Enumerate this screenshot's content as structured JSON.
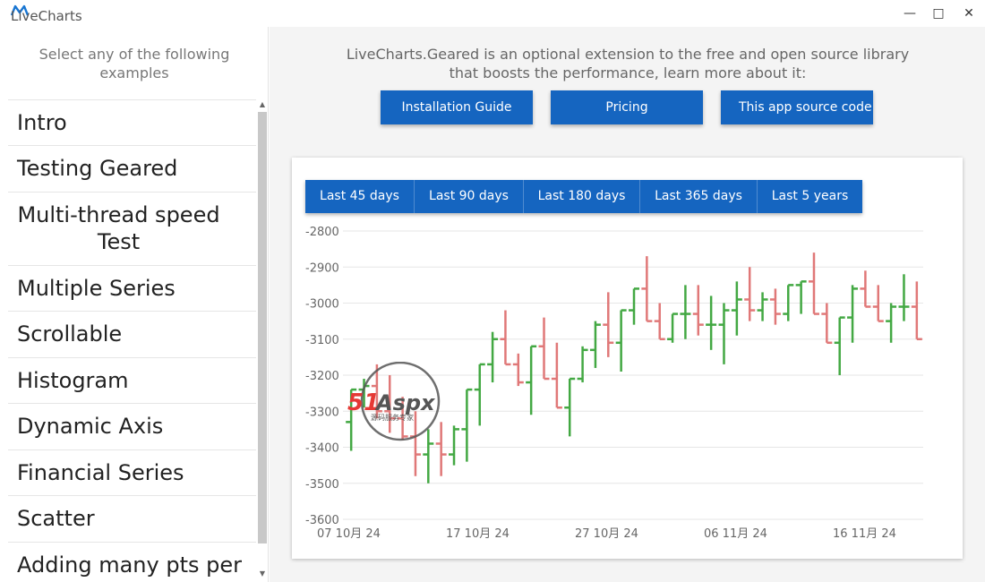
{
  "window": {
    "title": "LiveCharts",
    "minimize_glyph": "—",
    "maximize_glyph": "□",
    "close_glyph": "✕"
  },
  "sidebar": {
    "header": "Select any of the following examples",
    "items": [
      "Intro",
      "Testing Geared",
      "Multi-thread speed Test",
      "Multiple Series",
      "Scrollable",
      "Histogram",
      "Dynamic Axis",
      "Financial Series",
      "Scatter",
      "Adding many pts per"
    ]
  },
  "main": {
    "intro_text": "LiveCharts.Geared is an optional extension to the free and open source library that boosts the performance, learn more about it:",
    "buttons": [
      "Installation Guide",
      "Pricing",
      "This app source code"
    ]
  },
  "chart_controls": {
    "ranges": [
      "Last 45 days",
      "Last 90 days",
      "Last 180 days",
      "Last 365 days",
      "Last 5 years"
    ]
  },
  "watermark": {
    "brand": "51Aspx",
    "subtitle": "源码服务专家"
  },
  "colors": {
    "accent": "#1565c0",
    "up": "#43a843",
    "down": "#e07878"
  },
  "chart_data": {
    "type": "ohlc",
    "x_tick_labels": [
      "07 10月 24",
      "17 10月 24",
      "27 10月 24",
      "06 11月 24",
      "16 11月 24"
    ],
    "y_ticks": [
      -2800,
      -2900,
      -3000,
      -3100,
      -3200,
      -3300,
      -3400,
      -3500,
      -3600
    ],
    "ylim": [
      -3600,
      -2800
    ],
    "candles": [
      {
        "day": 0,
        "open": -3330,
        "high": -3240,
        "low": -3410,
        "close": -3240
      },
      {
        "day": 1,
        "open": -3240,
        "high": -3210,
        "low": -3290,
        "close": -3230
      },
      {
        "day": 2,
        "open": -3230,
        "high": -3170,
        "low": -3320,
        "close": -3300
      },
      {
        "day": 3,
        "open": -3300,
        "high": -3200,
        "low": -3360,
        "close": -3320
      },
      {
        "day": 4,
        "open": -3320,
        "high": -3260,
        "low": -3380,
        "close": -3370
      },
      {
        "day": 5,
        "open": -3370,
        "high": -3300,
        "low": -3480,
        "close": -3420
      },
      {
        "day": 6,
        "open": -3420,
        "high": -3350,
        "low": -3500,
        "close": -3390
      },
      {
        "day": 7,
        "open": -3390,
        "high": -3330,
        "low": -3480,
        "close": -3420
      },
      {
        "day": 8,
        "open": -3420,
        "high": -3340,
        "low": -3450,
        "close": -3350
      },
      {
        "day": 9,
        "open": -3350,
        "high": -3300,
        "low": -3440,
        "close": -3240
      },
      {
        "day": 10,
        "open": -3240,
        "high": -3170,
        "low": -3340,
        "close": -3170
      },
      {
        "day": 11,
        "open": -3170,
        "high": -3080,
        "low": -3220,
        "close": -3100
      },
      {
        "day": 12,
        "open": -3100,
        "high": -3020,
        "low": -3170,
        "close": -3170
      },
      {
        "day": 13,
        "open": -3170,
        "high": -3140,
        "low": -3230,
        "close": -3220
      },
      {
        "day": 14,
        "open": -3220,
        "high": -3120,
        "low": -3310,
        "close": -3120
      },
      {
        "day": 15,
        "open": -3120,
        "high": -3040,
        "low": -3210,
        "close": -3210
      },
      {
        "day": 16,
        "open": -3210,
        "high": -3110,
        "low": -3290,
        "close": -3290
      },
      {
        "day": 17,
        "open": -3290,
        "high": -3210,
        "low": -3370,
        "close": -3210
      },
      {
        "day": 18,
        "open": -3210,
        "high": -3120,
        "low": -3220,
        "close": -3130
      },
      {
        "day": 19,
        "open": -3130,
        "high": -3050,
        "low": -3180,
        "close": -3060
      },
      {
        "day": 20,
        "open": -3060,
        "high": -2970,
        "low": -3150,
        "close": -3110
      },
      {
        "day": 21,
        "open": -3110,
        "high": -3020,
        "low": -3190,
        "close": -3020
      },
      {
        "day": 22,
        "open": -3020,
        "high": -2960,
        "low": -3060,
        "close": -2960
      },
      {
        "day": 23,
        "open": -2960,
        "high": -2870,
        "low": -3050,
        "close": -3050
      },
      {
        "day": 24,
        "open": -3050,
        "high": -3000,
        "low": -3100,
        "close": -3100
      },
      {
        "day": 25,
        "open": -3100,
        "high": -3030,
        "low": -3110,
        "close": -3030
      },
      {
        "day": 26,
        "open": -3030,
        "high": -2950,
        "low": -3100,
        "close": -3030
      },
      {
        "day": 27,
        "open": -3030,
        "high": -2950,
        "low": -3090,
        "close": -3060
      },
      {
        "day": 28,
        "open": -3060,
        "high": -2980,
        "low": -3130,
        "close": -3060
      },
      {
        "day": 29,
        "open": -3060,
        "high": -3000,
        "low": -3170,
        "close": -3020
      },
      {
        "day": 30,
        "open": -3020,
        "high": -2940,
        "low": -3090,
        "close": -2990
      },
      {
        "day": 31,
        "open": -2990,
        "high": -2900,
        "low": -3050,
        "close": -3020
      },
      {
        "day": 32,
        "open": -3020,
        "high": -2970,
        "low": -3050,
        "close": -2990
      },
      {
        "day": 33,
        "open": -2990,
        "high": -2960,
        "low": -3060,
        "close": -3030
      },
      {
        "day": 34,
        "open": -3030,
        "high": -2950,
        "low": -3050,
        "close": -2950
      },
      {
        "day": 35,
        "open": -2950,
        "high": -2950,
        "low": -3030,
        "close": -2940
      },
      {
        "day": 36,
        "open": -2940,
        "high": -2860,
        "low": -3030,
        "close": -3030
      },
      {
        "day": 37,
        "open": -3030,
        "high": -3000,
        "low": -3110,
        "close": -3110
      },
      {
        "day": 38,
        "open": -3110,
        "high": -3040,
        "low": -3200,
        "close": -3040
      },
      {
        "day": 39,
        "open": -3040,
        "high": -2950,
        "low": -3110,
        "close": -2960
      },
      {
        "day": 40,
        "open": -2960,
        "high": -2910,
        "low": -3010,
        "close": -3010
      },
      {
        "day": 41,
        "open": -3010,
        "high": -2950,
        "low": -3050,
        "close": -3050
      },
      {
        "day": 42,
        "open": -3050,
        "high": -3000,
        "low": -3110,
        "close": -3010
      },
      {
        "day": 43,
        "open": -3010,
        "high": -2920,
        "low": -3050,
        "close": -3010
      },
      {
        "day": 44,
        "open": -3010,
        "high": -2940,
        "low": -3100,
        "close": -3100
      }
    ]
  }
}
